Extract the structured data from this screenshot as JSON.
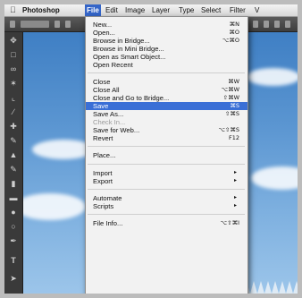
{
  "menubar": {
    "apple_icon": "apple-icon",
    "app_name": "Photoshop",
    "items": [
      "File",
      "Edit",
      "Image",
      "Layer",
      "Type",
      "Select",
      "Filter",
      "V"
    ]
  },
  "file_menu": {
    "items": [
      {
        "label": "New...",
        "shortcut": "⌘N"
      },
      {
        "label": "Open...",
        "shortcut": "⌘O"
      },
      {
        "label": "Browse in Bridge...",
        "shortcut": "⌥⌘O"
      },
      {
        "label": "Browse in Mini Bridge...",
        "shortcut": ""
      },
      {
        "label": "Open as Smart Object...",
        "shortcut": ""
      },
      {
        "label": "Open Recent",
        "shortcut": "",
        "submenu": true
      },
      {
        "label": "Close",
        "shortcut": "⌘W"
      },
      {
        "label": "Close All",
        "shortcut": "⌥⌘W"
      },
      {
        "label": "Close and Go to Bridge...",
        "shortcut": "⇧⌘W"
      },
      {
        "label": "Save",
        "shortcut": "⌘S",
        "highlighted": true
      },
      {
        "label": "Save As...",
        "shortcut": "⇧⌘S"
      },
      {
        "label": "Check In...",
        "shortcut": "",
        "disabled": true
      },
      {
        "label": "Save for Web...",
        "shortcut": "⌥⇧⌘S"
      },
      {
        "label": "Revert",
        "shortcut": "F12"
      },
      {
        "label": "Place...",
        "shortcut": ""
      },
      {
        "label": "Import",
        "shortcut": "",
        "submenu": true
      },
      {
        "label": "Export",
        "shortcut": "",
        "submenu": true
      },
      {
        "label": "Automate",
        "shortcut": "",
        "submenu": true
      },
      {
        "label": "Scripts",
        "shortcut": "",
        "submenu": true
      },
      {
        "label": "File Info...",
        "shortcut": "⌥⇧⌘I"
      }
    ],
    "submenu_arrow": "▸"
  },
  "toolbar": {
    "tools": [
      "move-tool",
      "marquee-tool",
      "lasso-tool",
      "quick-select-tool",
      "crop-tool",
      "eyedropper-tool",
      "healing-tool",
      "brush-tool",
      "clone-stamp-tool",
      "history-brush-tool",
      "eraser-tool",
      "gradient-tool",
      "blur-tool",
      "dodge-tool",
      "pen-tool",
      "type-tool",
      "path-select-tool"
    ]
  },
  "colors": {
    "highlight": "#3a6fd6",
    "menubar_active": "#3465c8",
    "sky": "#5a95d1"
  }
}
